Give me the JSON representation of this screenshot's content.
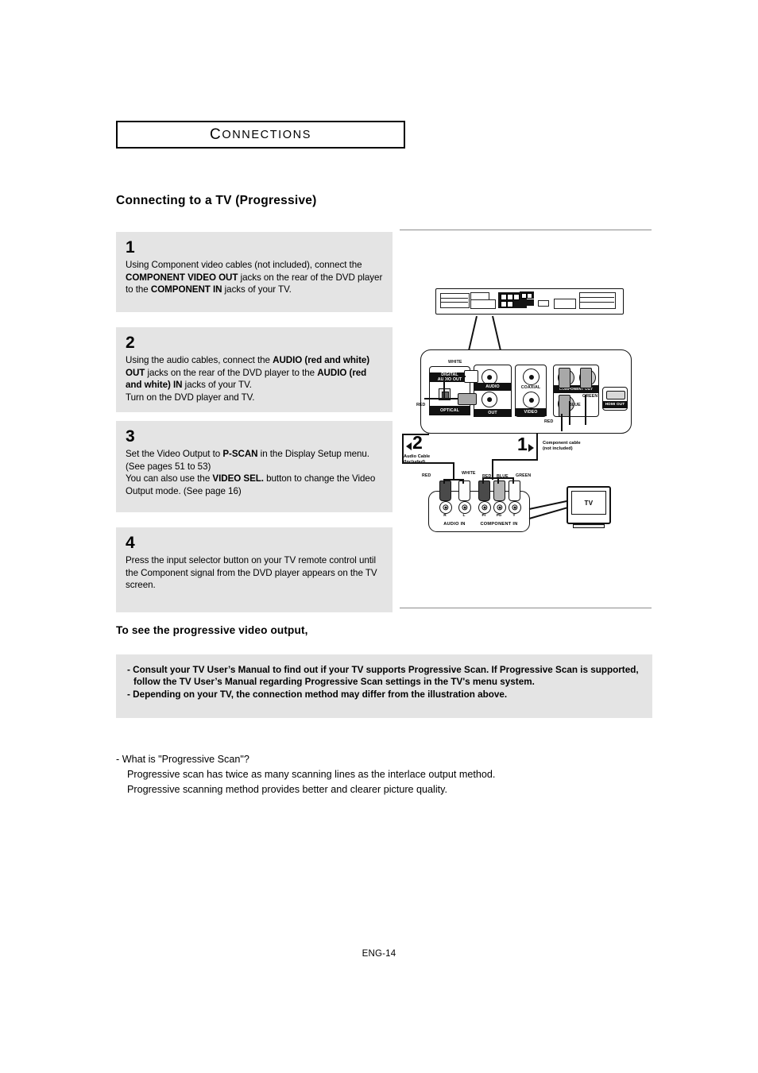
{
  "chapter": {
    "label_first": "C",
    "label_rest": "ONNECTIONS",
    "full": "CONNECTIONS"
  },
  "section": {
    "title": "Connecting to a TV (Progressive)"
  },
  "steps": [
    {
      "number": "1",
      "lines": [
        {
          "parts": [
            {
              "t": "Using Component video cables (not included), connect the ",
              "b": false
            }
          ]
        },
        {
          "parts": [
            {
              "t": "COMPONENT VIDEO OUT",
              "b": true
            },
            {
              "t": " jacks on the rear of the DVD player",
              "b": false
            }
          ]
        },
        {
          "parts": [
            {
              "t": "to the ",
              "b": false
            },
            {
              "t": "COMPONENT IN",
              "b": true
            },
            {
              "t": " jacks of your TV.",
              "b": false
            }
          ]
        }
      ]
    },
    {
      "number": "2",
      "lines": [
        {
          "parts": [
            {
              "t": "Using the audio cables, connect the ",
              "b": false
            },
            {
              "t": "AUDIO (red and white)",
              "b": true
            }
          ]
        },
        {
          "parts": [
            {
              "t": "OUT",
              "b": true
            },
            {
              "t": " jacks on the rear of the DVD player to the ",
              "b": false
            },
            {
              "t": "AUDIO (red",
              "b": true
            }
          ]
        },
        {
          "parts": [
            {
              "t": "and white) IN",
              "b": true
            },
            {
              "t": " jacks of your TV.",
              "b": false
            }
          ]
        },
        {
          "parts": [
            {
              "t": "Turn on the DVD player and TV.",
              "b": false
            }
          ]
        }
      ]
    },
    {
      "number": "3",
      "lines": [
        {
          "parts": [
            {
              "t": "Set the Video Output to ",
              "b": false
            },
            {
              "t": "P-SCAN",
              "b": true
            },
            {
              "t": " in the Display Setup menu.",
              "b": false
            }
          ]
        },
        {
          "parts": [
            {
              "t": "(See pages 51 to 53)",
              "b": false
            }
          ]
        },
        {
          "parts": [
            {
              "t": "You can also use the ",
              "b": false
            },
            {
              "t": "VIDEO SEL.",
              "b": true
            },
            {
              "t": " button to change the Video",
              "b": false
            }
          ]
        },
        {
          "parts": [
            {
              "t": "Output mode. (See page 16)",
              "b": false
            }
          ]
        }
      ]
    },
    {
      "number": "4",
      "lines": [
        {
          "parts": [
            {
              "t": "Press the input selector button on your TV remote control until",
              "b": false
            }
          ]
        },
        {
          "parts": [
            {
              "t": "the Component signal from the DVD player appears on the TV",
              "b": false
            }
          ]
        },
        {
          "parts": [
            {
              "t": "screen.",
              "b": false
            }
          ]
        }
      ]
    }
  ],
  "diagram": {
    "dvd_panel": {
      "digital_audio_out": "DIGITAL\nAUDIO OUT",
      "optical": "OPTICAL",
      "audio": "AUDIO",
      "out": "OUT",
      "coaxial": "COAXIAL",
      "video": "VIDEO",
      "component_out": "COMPONENT OUT",
      "hdmi_out": "HDMI OUT",
      "label_white": "WHITE",
      "label_red_audio": "RED",
      "label_green": "GREEN",
      "label_blue": "BLUE",
      "label_red_comp": "RED"
    },
    "callouts": {
      "number_1": "1",
      "number_2": "2",
      "audio_cable": "Audio Cable\n(Included)",
      "component_cable": "Component cable\n(not included)"
    },
    "tv_panel": {
      "label_red": "RED",
      "label_white": "WHITE",
      "label_comp_red": "RED",
      "label_comp_blue": "BLUE",
      "label_comp_green": "GREEN",
      "audio_in": "AUDIO IN",
      "component_in": "COMPONENT IN",
      "jack_r": "R",
      "jack_l": "L",
      "jack_pr": "Pr",
      "jack_pb": "Pb",
      "jack_y": "Y",
      "tv_label": "TV"
    }
  },
  "progressive": {
    "heading": "To see the progressive video output,",
    "notes": [
      "- Consult your TV User’s Manual to find out if your TV supports Progressive Scan. If Progressive Scan is supported, follow the TV User’s Manual regarding Progressive Scan settings in the TV's menu system.",
      "- Depending on your TV, the connection method may differ from the illustration above."
    ],
    "info": {
      "question": "-  What is \"Progressive Scan\"?",
      "line1": "Progressive scan has twice as many scanning lines as the interlace output method.",
      "line2": "Progressive scanning method provides better and clearer picture quality."
    }
  },
  "footer": {
    "page": "ENG-14"
  },
  "colors": {
    "step_bg": "#e4e4e4",
    "rule": "#8c8c8c",
    "text": "#000000"
  }
}
